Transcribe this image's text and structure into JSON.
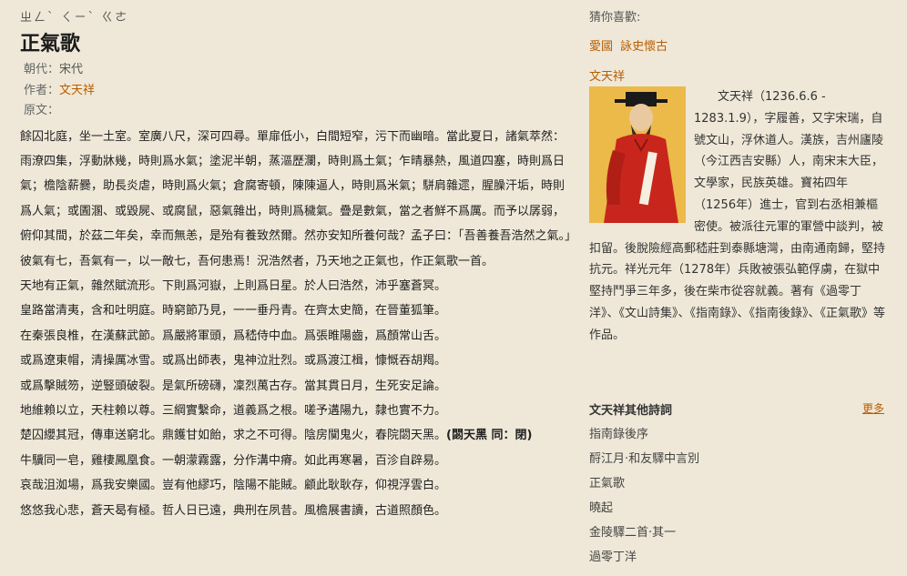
{
  "poem": {
    "zhuyin": "ㄓㄥˋ ㄑㄧˋ ㄍㄜ",
    "title": "正氣歌",
    "dynasty_label": "朝代：",
    "dynasty": "宋代",
    "author_label": "作者：",
    "author": "文天祥",
    "source_label": "原文：",
    "paragraphs": [
      "餘囚北庭，坐一土室。室廣八尺，深可四尋。單扉低小，白間短窄，污下而幽暗。當此夏日，諸氣萃然：雨潦四集，浮動牀幾，時則爲水氣；塗泥半朝，蒸漚歷瀾，時則爲土氣；乍晴暴熱，風道四塞，時則爲日氣；檐陰薪爨，助長炎虐，時則爲火氣；倉腐寄頓，陳陳逼人，時則爲米氣；駢肩雜遝，腥臊汗垢，時則爲人氣；或圊溷、或毀屍、或腐鼠，惡氣雜出，時則爲穢氣。疊是數氣，當之者鮮不爲厲。而予以孱弱，俯仰其間，於茲二年矣，幸而無恙，是殆有養致然爾。然亦安知所養何哉？孟子曰：「吾善養吾浩然之氣。」彼氣有七，吾氣有一，以一敵七，吾何患焉！況浩然者，乃天地之正氣也，作正氣歌一首。",
      "天地有正氣，雜然賦流形。下則爲河嶽，上則爲日星。於人曰浩然，沛乎塞蒼冥。",
      "皇路當清夷，含和吐明庭。時窮節乃見，一一垂丹青。在齊太史簡，在晉董狐筆。",
      "在秦張良椎，在漢蘇武節。爲嚴將軍頭，爲嵇侍中血。爲張睢陽齒，爲顏常山舌。",
      "或爲遼東帽，清操厲冰雪。或爲出師表，鬼神泣壯烈。或爲渡江楫，慷慨吞胡羯。",
      "或爲擊賊笏，逆豎頭破裂。是氣所磅礴，凜烈萬古存。當其貫日月，生死安足論。",
      "地維賴以立，天柱賴以尊。三綱實繫命，道義爲之根。嗟予遘陽九，隸也實不力。"
    ],
    "para_chuqiu": "楚囚纓其冠，傳車送窮北。鼎鑊甘如飴，求之不可得。陰房闃鬼火，春院閟天黑。",
    "para_chuqiu_note": "(閟天黑 同：閉)",
    "paragraphs2": [
      "牛驥同一皂，雞棲鳳凰食。一朝濛霧露，分作溝中瘠。如此再寒暑，百沴自辟易。",
      "哀哉沮洳場，爲我安樂國。豈有他繆巧，陰陽不能賊。顧此耿耿存，仰視浮雲白。",
      "悠悠我心悲，蒼天曷有極。哲人日已遠，典刑在夙昔。風檐展書讀，古道照顏色。"
    ]
  },
  "sidebar": {
    "recommend_heading": "猜你喜歡:",
    "tags": [
      "愛國",
      "詠史懷古"
    ],
    "author_name": "文天祥",
    "author_bio": "文天祥（1236.6.6 - 1283.1.9），字履善，又字宋瑞，自號文山，浮休道人。漢族，吉州廬陵（今江西吉安縣）人，南宋末大臣，文學家，民族英雄。寶祐四年（1256年）進士，官到右丞相兼樞密使。被派往元軍的軍營中談判，被扣留。後脫險經高郵嵇莊到泰縣塘灣，由南通南歸，堅持抗元。祥光元年（1278年）兵敗被張弘範俘虜，在獄中堅持鬥爭三年多，後在柴市從容就義。著有《過零丁洋》、《文山詩集》、《指南錄》、《指南後錄》、《正氣歌》等作品。",
    "other_poems_heading": "文天祥其他詩詞",
    "more_label": "更多",
    "other_poems": [
      "指南錄後序",
      "酹江月·和友驛中言別",
      "正氣歌",
      "曉起",
      "金陵驛二首·其一",
      "過零丁洋"
    ]
  },
  "colors": {
    "background": "#efe8d8",
    "link": "#b85c00",
    "portrait_bg": "#e8b23a",
    "robe": "#c8261c"
  },
  "icons": {
    "portrait": "author-portrait-image"
  }
}
